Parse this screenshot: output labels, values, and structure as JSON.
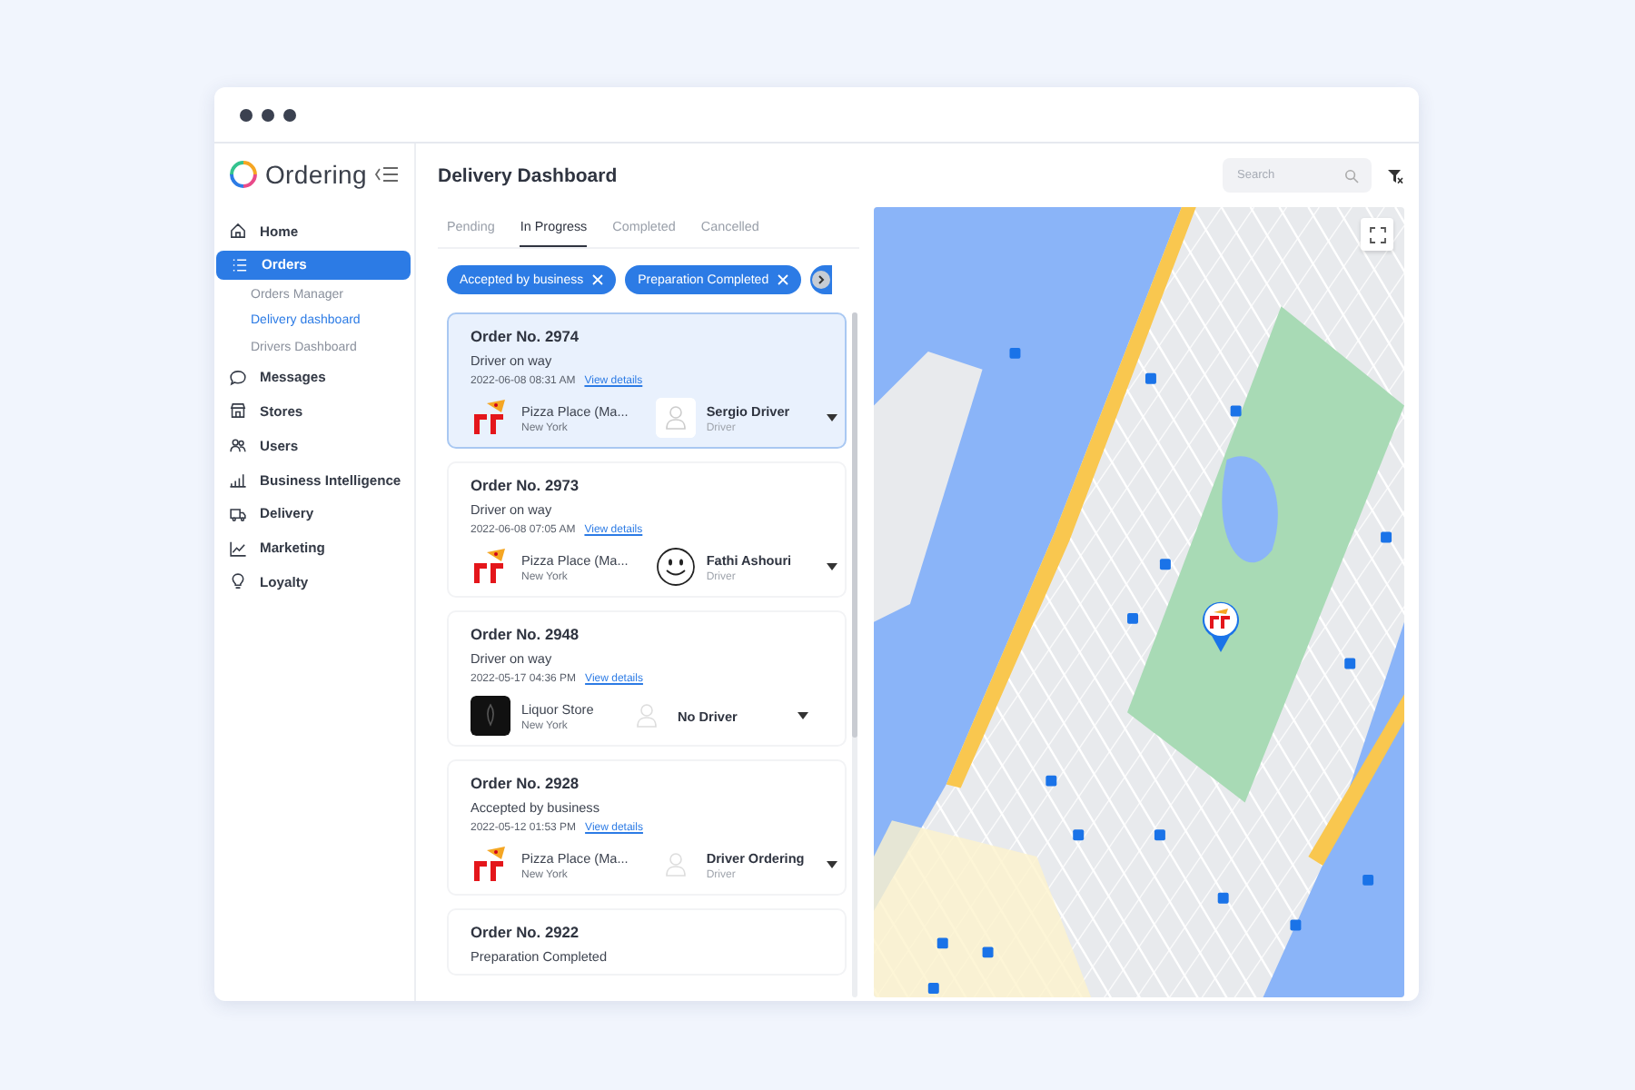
{
  "brand": {
    "name": "Ordering"
  },
  "sidebar": {
    "items": [
      {
        "label": "Home",
        "kind": "home",
        "selected": false
      },
      {
        "label": "Orders",
        "kind": "list",
        "selected": true,
        "children": [
          {
            "label": "Orders Manager",
            "selected": false
          },
          {
            "label": "Delivery dashboard",
            "selected": true
          },
          {
            "label": "Drivers Dashboard",
            "selected": false
          }
        ]
      },
      {
        "label": "Messages",
        "kind": "chat",
        "selected": false
      },
      {
        "label": "Stores",
        "kind": "store",
        "selected": false
      },
      {
        "label": "Users",
        "kind": "users",
        "selected": false
      },
      {
        "label": "Business Intelligence",
        "kind": "bars",
        "selected": false
      },
      {
        "label": "Delivery",
        "kind": "truck",
        "selected": false
      },
      {
        "label": "Marketing",
        "kind": "chart",
        "selected": false
      },
      {
        "label": "Loyalty",
        "kind": "bulb",
        "selected": false
      }
    ]
  },
  "header": {
    "title": "Delivery Dashboard",
    "search": {
      "placeholder": "Search"
    }
  },
  "tabs": [
    {
      "label": "Pending",
      "selected": false
    },
    {
      "label": "In Progress",
      "selected": true
    },
    {
      "label": "Completed",
      "selected": false
    },
    {
      "label": "Cancelled",
      "selected": false
    }
  ],
  "filters": [
    {
      "label": "Accepted by business"
    },
    {
      "label": "Preparation Completed"
    }
  ],
  "orders": [
    {
      "number": "Order No. 2974",
      "status": "Driver on way",
      "date": "2022-06-08 08:31 AM",
      "link": "View details",
      "business": {
        "name": "Pizza Place (Ma...",
        "city": "New York",
        "kind": "pizza"
      },
      "driver": {
        "name": "Sergio Driver",
        "role": "Driver",
        "kind": "placeholder"
      },
      "selected": true
    },
    {
      "number": "Order No. 2973",
      "status": "Driver on way",
      "date": "2022-06-08 07:05 AM",
      "link": "View details",
      "business": {
        "name": "Pizza Place (Ma...",
        "city": "New York",
        "kind": "pizza"
      },
      "driver": {
        "name": "Fathi Ashouri",
        "role": "Driver",
        "kind": "smiley"
      },
      "selected": false
    },
    {
      "number": "Order No. 2948",
      "status": "Driver on way",
      "date": "2022-05-17 04:36 PM",
      "link": "View details",
      "business": {
        "name": "Liquor Store",
        "city": "New York",
        "kind": "dark"
      },
      "driver": {
        "name": "No Driver",
        "kind": "faint"
      },
      "selected": false
    },
    {
      "number": "Order No. 2928",
      "status": "Accepted by business",
      "date": "2022-05-12 01:53 PM",
      "link": "View details",
      "business": {
        "name": "Pizza Place (Ma...",
        "city": "New York",
        "kind": "pizza"
      },
      "driver": {
        "name": "Driver Ordering",
        "role": "Driver",
        "kind": "faint"
      },
      "selected": false
    },
    {
      "number": "Order No. 2922",
      "status": "Preparation Completed",
      "selected": false
    }
  ]
}
